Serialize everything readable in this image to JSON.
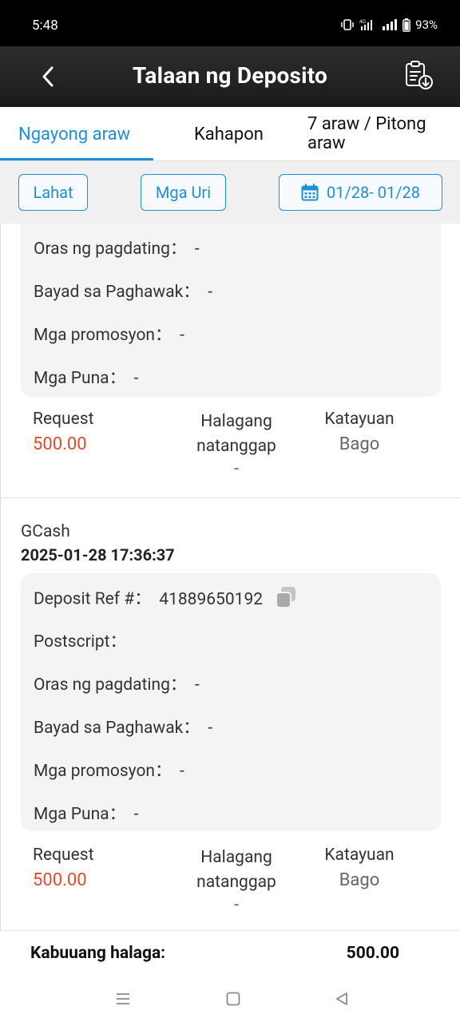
{
  "status": {
    "time": "5:48",
    "battery": "93%"
  },
  "header": {
    "title": "Talaan ng Deposito"
  },
  "tabs": [
    {
      "label": "Ngayong araw",
      "active": true
    },
    {
      "label": "Kahapon",
      "active": false
    },
    {
      "label": "7 araw / Pitong araw",
      "active": false
    }
  ],
  "filters": {
    "all_label": "Lahat",
    "types_label": "Mga Uri",
    "date_range": "01/28- 01/28"
  },
  "records": [
    {
      "fields": [
        {
          "label": "Oras ng pagdating：",
          "value": "-"
        },
        {
          "label": "Bayad sa Paghawak：",
          "value": "-"
        },
        {
          "label": "Mga promosyon：",
          "value": "-"
        },
        {
          "label": "Mga Puna：",
          "value": "-"
        }
      ],
      "summary": {
        "request_label": "Request",
        "request_value": "500.00",
        "received_label": "Halagang natanggap",
        "received_value": "-",
        "status_label": "Katayuan",
        "status_value": "Bago"
      }
    },
    {
      "method": "GCash",
      "datetime": "2025-01-28 17:36:37",
      "fields": [
        {
          "label": "Deposit Ref #：",
          "value": "41889650192"
        },
        {
          "label": "Postscript：",
          "value": ""
        },
        {
          "label": "Oras ng pagdating：",
          "value": "-"
        },
        {
          "label": "Bayad sa Paghawak：",
          "value": "-"
        },
        {
          "label": "Mga promosyon：",
          "value": "-"
        },
        {
          "label": "Mga Puna：",
          "value": "-"
        }
      ],
      "summary": {
        "request_label": "Request",
        "request_value": "500.00",
        "received_label": "Halagang natanggap",
        "received_value": "-",
        "status_label": "Katayuan",
        "status_value": "Bago"
      }
    }
  ],
  "footer": {
    "total_label": "Kabuuang halaga:",
    "total_value": "500.00"
  },
  "colors": {
    "accent": "#1f8fd6",
    "request_amount": "#e14a2b"
  },
  "icons": [
    "back-icon",
    "report-download-icon",
    "calendar-icon",
    "copy-icon",
    "menu-icon",
    "home-icon",
    "back-triangle-icon"
  ]
}
